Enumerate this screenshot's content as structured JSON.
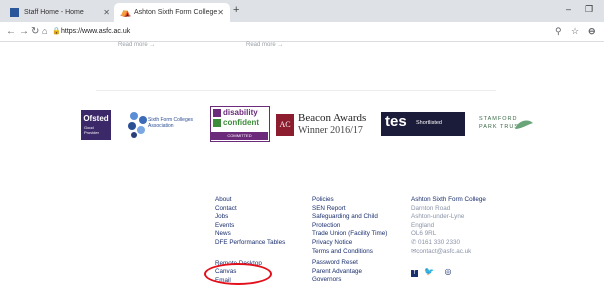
{
  "browser": {
    "tabs": [
      {
        "title": "Staff Home - Home",
        "active": false
      },
      {
        "title": "Ashton Sixth Form College",
        "active": true
      }
    ],
    "new_tab": "+",
    "window_controls": {
      "minimize": "–",
      "maximize": "❐",
      "close": "✕"
    },
    "address": "https://www.asfc.ac.uk",
    "icons": [
      "back-icon",
      "forward-icon",
      "reload-icon",
      "home-icon",
      "lock-icon",
      "zoom-icon",
      "bookmark-star-icon",
      "profile-icon"
    ]
  },
  "read_more": [
    "Read more →",
    "Read more →"
  ],
  "logos": {
    "ofsted": {
      "title": "Ofsted",
      "sub1": "Good",
      "sub2": "Provider"
    },
    "sixth_form": {
      "line1": "Sixth Form Colleges",
      "line2": "Association"
    },
    "disability": {
      "line1": "disability",
      "line2": "confident",
      "line3": "COMMITTED"
    },
    "beacon": {
      "mark": "AC",
      "line1": "Beacon Awards",
      "line2": "Winner 2016/17"
    },
    "tes": {
      "mark": "tes",
      "label": "Shortlisted"
    },
    "stamford": {
      "line1": "STAMFORD",
      "line2": "PARK TRUST"
    }
  },
  "footer": {
    "col1": [
      "About",
      "Contact",
      "Jobs",
      "Events",
      "News",
      "DFE Performance Tables",
      "",
      "Remote Desktop",
      "Canvas",
      "Email"
    ],
    "col2": [
      "Policies",
      "SEN Report",
      "Safeguarding and Child",
      "Protection",
      "Trade Union (Facility Time)",
      "Privacy Notice",
      "Terms and Conditions",
      "",
      "Password Reset",
      "Parent Advantage",
      "Governors"
    ],
    "contact": {
      "name": "Ashton Sixth Form College",
      "address1": "Darnton Road",
      "address2": "Ashton-under-Lyne",
      "address3": "England",
      "postcode": "OL6 9RL",
      "phone": "0161 330 2330",
      "email": "contact@asfc.ac.uk"
    },
    "social_icons": [
      "facebook-icon",
      "twitter-icon",
      "instagram-icon"
    ]
  },
  "colors": {
    "footer_text": "#1a2f6e",
    "highlight": "#e3101b",
    "tab_bar": "#dee1e6"
  }
}
